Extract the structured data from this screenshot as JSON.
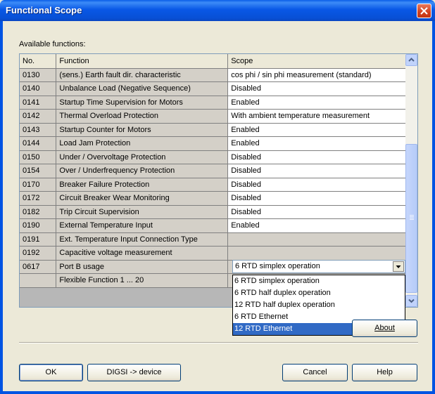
{
  "window": {
    "title": "Functional Scope",
    "close_icon": "close-icon"
  },
  "available_label": "Available functions:",
  "available_label_accel": "v",
  "grid": {
    "columns": [
      "No.",
      "Function",
      "Scope"
    ],
    "rows": [
      {
        "no": "0130",
        "function": "(sens.) Earth fault dir. characteristic",
        "scope": "cos phi / sin phi measurement (standard)"
      },
      {
        "no": "0140",
        "function": "Unbalance Load (Negative Sequence)",
        "scope": "Disabled"
      },
      {
        "no": "0141",
        "function": "Startup Time Supervision for Motors",
        "scope": "Enabled"
      },
      {
        "no": "0142",
        "function": "Thermal Overload Protection",
        "scope": "With ambient temperature measurement"
      },
      {
        "no": "0143",
        "function": "Startup Counter for Motors",
        "scope": "Enabled"
      },
      {
        "no": "0144",
        "function": "Load Jam Protection",
        "scope": "Enabled"
      },
      {
        "no": "0150",
        "function": "Under / Overvoltage Protection",
        "scope": "Disabled"
      },
      {
        "no": "0154",
        "function": "Over / Underfrequency Protection",
        "scope": "Disabled"
      },
      {
        "no": "0170",
        "function": "Breaker Failure Protection",
        "scope": "Disabled"
      },
      {
        "no": "0172",
        "function": "Circuit Breaker Wear Monitoring",
        "scope": "Disabled"
      },
      {
        "no": "0182",
        "function": "Trip Circuit Supervision",
        "scope": "Disabled"
      },
      {
        "no": "0190",
        "function": "External Temperature Input",
        "scope": "Enabled"
      },
      {
        "no": "0191",
        "function": "Ext. Temperature Input Connection Type",
        "scope": ""
      },
      {
        "no": "0192",
        "function": "Capacitive voltage measurement",
        "scope": ""
      },
      {
        "no": "0617",
        "function": "Port B usage",
        "scope": ""
      },
      {
        "no": "",
        "function": "Flexible Function 1 ... 20",
        "scope": ""
      }
    ]
  },
  "combo": {
    "selected": "6 RTD simplex operation",
    "options": [
      "6 RTD simplex operation",
      "6 RTD half duplex operation",
      "12 RTD half duplex operation",
      "6 RTD Ethernet",
      "12 RTD Ethernet"
    ],
    "highlighted_index": 4
  },
  "buttons": {
    "about": "About",
    "ok": "OK",
    "digsi": "DIGSI -> device",
    "cancel": "Cancel",
    "help": "Help"
  },
  "colors": {
    "title_bar": "#0054e3",
    "selection": "#316ac5",
    "dialog_bg": "#ece9d8"
  }
}
